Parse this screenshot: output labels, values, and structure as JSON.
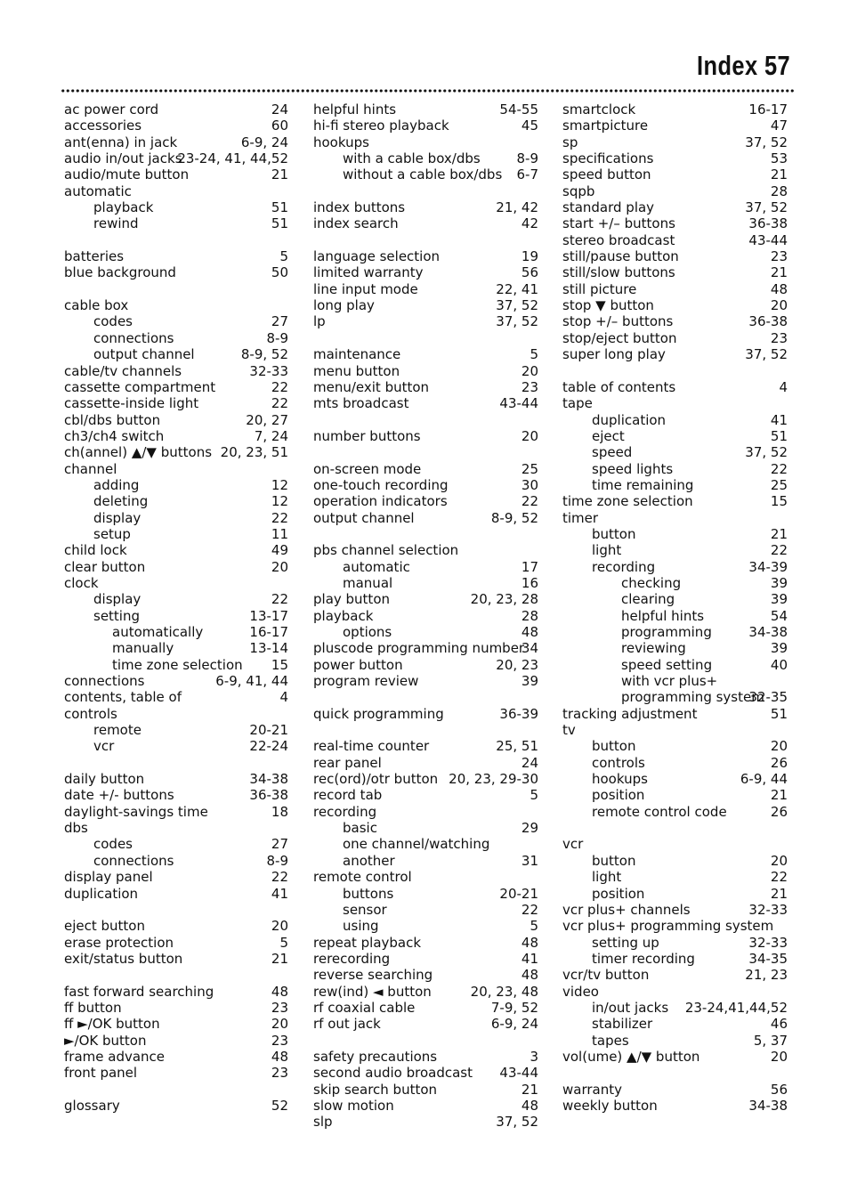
{
  "header": {
    "title": "Index 57"
  },
  "columns": [
    [
      {
        "t": "ac power cord",
        "p": "24",
        "l": 0
      },
      {
        "t": "accessories",
        "p": "60",
        "l": 0
      },
      {
        "t": "ant(enna) in jack",
        "p": "6-9, 24",
        "l": 0
      },
      {
        "t": "audio in/out jacks",
        "p": "23-24, 41, 44,52",
        "l": 0
      },
      {
        "t": "audio/mute button",
        "p": "21",
        "l": 0
      },
      {
        "t": "automatic",
        "p": "",
        "l": 0
      },
      {
        "t": "playback",
        "p": "51",
        "l": 1
      },
      {
        "t": "rewind",
        "p": "51",
        "l": 1
      },
      {
        "t": "",
        "p": "",
        "l": 0
      },
      {
        "t": "batteries",
        "p": "5",
        "l": 0
      },
      {
        "t": "blue background",
        "p": "50",
        "l": 0
      },
      {
        "t": "",
        "p": "",
        "l": 0
      },
      {
        "t": "cable box",
        "p": "",
        "l": 0
      },
      {
        "t": "codes",
        "p": "27",
        "l": 1
      },
      {
        "t": "connections",
        "p": "8-9",
        "l": 1
      },
      {
        "t": "output channel",
        "p": "8-9, 52",
        "l": 1
      },
      {
        "t": "cable/tv channels",
        "p": "32-33",
        "l": 0
      },
      {
        "t": "cassette compartment",
        "p": "22",
        "l": 0
      },
      {
        "t": "cassette-inside light",
        "p": "22",
        "l": 0
      },
      {
        "t": "cbl/dbs button",
        "p": "20, 27",
        "l": 0
      },
      {
        "t": "ch3/ch4 switch",
        "p": "7, 24",
        "l": 0
      },
      {
        "t": "ch(annel) ▲/▼ buttons",
        "p": "20, 23, 51",
        "l": 0
      },
      {
        "t": "channel",
        "p": "",
        "l": 0
      },
      {
        "t": "adding",
        "p": "12",
        "l": 1
      },
      {
        "t": "deleting",
        "p": "12",
        "l": 1
      },
      {
        "t": "display",
        "p": "22",
        "l": 1
      },
      {
        "t": "setup",
        "p": "11",
        "l": 1
      },
      {
        "t": "child lock",
        "p": "49",
        "l": 0
      },
      {
        "t": "clear button",
        "p": "20",
        "l": 0
      },
      {
        "t": "clock",
        "p": "",
        "l": 0
      },
      {
        "t": "display",
        "p": "22",
        "l": 1
      },
      {
        "t": "setting",
        "p": "13-17",
        "l": 1
      },
      {
        "t": "automatically",
        "p": "16-17",
        "l": 2
      },
      {
        "t": "manually",
        "p": "13-14",
        "l": 2
      },
      {
        "t": "time zone selection",
        "p": "15",
        "l": 2
      },
      {
        "t": "connections",
        "p": "6-9, 41, 44",
        "l": 0
      },
      {
        "t": "contents, table of",
        "p": "4",
        "l": 0
      },
      {
        "t": "controls",
        "p": "",
        "l": 0
      },
      {
        "t": "remote",
        "p": "20-21",
        "l": 1
      },
      {
        "t": "vcr",
        "p": "22-24",
        "l": 1
      },
      {
        "t": "",
        "p": "",
        "l": 0
      },
      {
        "t": "daily button",
        "p": "34-38",
        "l": 0
      },
      {
        "t": "date +/- buttons",
        "p": "36-38",
        "l": 0
      },
      {
        "t": "daylight-savings time",
        "p": "18",
        "l": 0
      },
      {
        "t": "dbs",
        "p": "",
        "l": 0
      },
      {
        "t": "codes",
        "p": "27",
        "l": 1
      },
      {
        "t": "connections",
        "p": "8-9",
        "l": 1
      },
      {
        "t": "display panel",
        "p": "22",
        "l": 0
      },
      {
        "t": "duplication",
        "p": "41",
        "l": 0
      },
      {
        "t": "",
        "p": "",
        "l": 0
      },
      {
        "t": "eject button",
        "p": "20",
        "l": 0
      },
      {
        "t": "erase protection",
        "p": "5",
        "l": 0
      },
      {
        "t": "exit/status button",
        "p": "21",
        "l": 0
      },
      {
        "t": "",
        "p": "",
        "l": 0
      },
      {
        "t": "fast forward searching",
        "p": "48",
        "l": 0
      },
      {
        "t": "ff button",
        "p": "23",
        "l": 0
      },
      {
        "t": "ff ►/OK button",
        "p": "20",
        "l": 0
      },
      {
        "t": "►/OK button",
        "p": "23",
        "l": 0
      },
      {
        "t": "frame advance",
        "p": "48",
        "l": 0
      },
      {
        "t": "front panel",
        "p": "23",
        "l": 0
      },
      {
        "t": "",
        "p": "",
        "l": 0
      },
      {
        "t": "glossary",
        "p": "52",
        "l": 0
      }
    ],
    [
      {
        "t": "helpful hints",
        "p": "54-55",
        "l": 0
      },
      {
        "t": "hi-fi stereo playback",
        "p": "45",
        "l": 0
      },
      {
        "t": "hookups",
        "p": "",
        "l": 0
      },
      {
        "t": "with a cable box/dbs",
        "p": "8-9",
        "l": 1
      },
      {
        "t": "without a cable box/dbs",
        "p": "6-7",
        "l": 1
      },
      {
        "t": "",
        "p": "",
        "l": 0
      },
      {
        "t": "index buttons",
        "p": "21, 42",
        "l": 0
      },
      {
        "t": "index search",
        "p": "42",
        "l": 0
      },
      {
        "t": "",
        "p": "",
        "l": 0
      },
      {
        "t": "language selection",
        "p": "19",
        "l": 0
      },
      {
        "t": "limited warranty",
        "p": "56",
        "l": 0
      },
      {
        "t": "line input mode",
        "p": "22, 41",
        "l": 0
      },
      {
        "t": "long play",
        "p": "37, 52",
        "l": 0
      },
      {
        "t": "lp",
        "p": "37, 52",
        "l": 0
      },
      {
        "t": "",
        "p": "",
        "l": 0
      },
      {
        "t": "maintenance",
        "p": "5",
        "l": 0
      },
      {
        "t": "menu button",
        "p": "20",
        "l": 0
      },
      {
        "t": "menu/exit button",
        "p": "23",
        "l": 0
      },
      {
        "t": "mts broadcast",
        "p": "43-44",
        "l": 0
      },
      {
        "t": "",
        "p": "",
        "l": 0
      },
      {
        "t": "number buttons",
        "p": "20",
        "l": 0
      },
      {
        "t": "",
        "p": "",
        "l": 0
      },
      {
        "t": "on-screen mode",
        "p": "25",
        "l": 0
      },
      {
        "t": "one-touch recording",
        "p": "30",
        "l": 0
      },
      {
        "t": "operation indicators",
        "p": "22",
        "l": 0
      },
      {
        "t": "output channel",
        "p": "8-9, 52",
        "l": 0
      },
      {
        "t": "",
        "p": "",
        "l": 0
      },
      {
        "t": "pbs channel selection",
        "p": "",
        "l": 0
      },
      {
        "t": "automatic",
        "p": "17",
        "l": 1
      },
      {
        "t": "manual",
        "p": "16",
        "l": 1
      },
      {
        "t": "play button",
        "p": "20, 23, 28",
        "l": 0
      },
      {
        "t": "playback",
        "p": "28",
        "l": 0
      },
      {
        "t": "options",
        "p": "48",
        "l": 1
      },
      {
        "t": "pluscode programming number",
        "p": "34",
        "l": 0
      },
      {
        "t": "power button",
        "p": "20, 23",
        "l": 0
      },
      {
        "t": "program review",
        "p": "39",
        "l": 0
      },
      {
        "t": "",
        "p": "",
        "l": 0
      },
      {
        "t": "quick programming",
        "p": "36-39",
        "l": 0
      },
      {
        "t": "",
        "p": "",
        "l": 0
      },
      {
        "t": "real-time counter",
        "p": "25, 51",
        "l": 0
      },
      {
        "t": "rear panel",
        "p": "24",
        "l": 0
      },
      {
        "t": "rec(ord)/otr button",
        "p": "20, 23, 29-30",
        "l": 0
      },
      {
        "t": "record tab",
        "p": "5",
        "l": 0
      },
      {
        "t": "recording",
        "p": "",
        "l": 0
      },
      {
        "t": "basic",
        "p": "29",
        "l": 1
      },
      {
        "t": "one channel/watching",
        "p": "",
        "l": 1
      },
      {
        "t": "another",
        "p": "31",
        "l": 1
      },
      {
        "t": "remote control",
        "p": "",
        "l": 0
      },
      {
        "t": "buttons",
        "p": "20-21",
        "l": 1
      },
      {
        "t": "sensor",
        "p": "22",
        "l": 1
      },
      {
        "t": "using",
        "p": "5",
        "l": 1
      },
      {
        "t": "repeat playback",
        "p": "48",
        "l": 0
      },
      {
        "t": "rerecording",
        "p": "41",
        "l": 0
      },
      {
        "t": "reverse searching",
        "p": "48",
        "l": 0
      },
      {
        "t": "rew(ind) ◄ button",
        "p": "20, 23, 48",
        "l": 0
      },
      {
        "t": "rf coaxial cable",
        "p": "7-9, 52",
        "l": 0
      },
      {
        "t": "rf out jack",
        "p": "6-9, 24",
        "l": 0
      },
      {
        "t": "",
        "p": "",
        "l": 0
      },
      {
        "t": "safety precautions",
        "p": "3",
        "l": 0
      },
      {
        "t": "second audio broadcast",
        "p": "43-44",
        "l": 0
      },
      {
        "t": "skip search button",
        "p": "21",
        "l": 0
      },
      {
        "t": "slow motion",
        "p": "48",
        "l": 0
      },
      {
        "t": "slp",
        "p": "37, 52",
        "l": 0
      }
    ],
    [
      {
        "t": "smartclock",
        "p": "16-17",
        "l": 0
      },
      {
        "t": "smartpicture",
        "p": "47",
        "l": 0
      },
      {
        "t": "sp",
        "p": "37, 52",
        "l": 0
      },
      {
        "t": "specifications",
        "p": "53",
        "l": 0
      },
      {
        "t": "speed button",
        "p": "21",
        "l": 0
      },
      {
        "t": "sqpb",
        "p": "28",
        "l": 0
      },
      {
        "t": "standard play",
        "p": "37, 52",
        "l": 0
      },
      {
        "t": "start +/– buttons",
        "p": "36-38",
        "l": 0
      },
      {
        "t": "stereo broadcast",
        "p": "43-44",
        "l": 0
      },
      {
        "t": "still/pause button",
        "p": "23",
        "l": 0
      },
      {
        "t": "still/slow buttons",
        "p": "21",
        "l": 0
      },
      {
        "t": "still picture",
        "p": "48",
        "l": 0
      },
      {
        "t": "stop ▼ button",
        "p": "20",
        "l": 0
      },
      {
        "t": "stop +/– buttons",
        "p": "36-38",
        "l": 0
      },
      {
        "t": "stop/eject button",
        "p": "23",
        "l": 0
      },
      {
        "t": "super long play",
        "p": "37, 52",
        "l": 0
      },
      {
        "t": "",
        "p": "",
        "l": 0
      },
      {
        "t": "table of contents",
        "p": "4",
        "l": 0
      },
      {
        "t": "tape",
        "p": "",
        "l": 0
      },
      {
        "t": "duplication",
        "p": "41",
        "l": 1
      },
      {
        "t": "eject",
        "p": "51",
        "l": 1
      },
      {
        "t": "speed",
        "p": "37, 52",
        "l": 1
      },
      {
        "t": "speed lights",
        "p": "22",
        "l": 1
      },
      {
        "t": "time remaining",
        "p": "25",
        "l": 1
      },
      {
        "t": "time zone selection",
        "p": "15",
        "l": 0
      },
      {
        "t": "timer",
        "p": "",
        "l": 0
      },
      {
        "t": "button",
        "p": "21",
        "l": 1
      },
      {
        "t": "light",
        "p": "22",
        "l": 1
      },
      {
        "t": "recording",
        "p": "34-39",
        "l": 1
      },
      {
        "t": "checking",
        "p": "39",
        "l": 2
      },
      {
        "t": "clearing",
        "p": "39",
        "l": 2
      },
      {
        "t": "helpful hints",
        "p": "54",
        "l": 2
      },
      {
        "t": "programming",
        "p": "34-38",
        "l": 2
      },
      {
        "t": "reviewing",
        "p": "39",
        "l": 2
      },
      {
        "t": "speed setting",
        "p": "40",
        "l": 2
      },
      {
        "t": "with vcr plus+",
        "p": "",
        "l": 2
      },
      {
        "t": "programming system",
        "p": "32-35",
        "l": 2
      },
      {
        "t": "tracking adjustment",
        "p": "51",
        "l": 0
      },
      {
        "t": "tv",
        "p": "",
        "l": 0
      },
      {
        "t": "button",
        "p": "20",
        "l": 1
      },
      {
        "t": "controls",
        "p": "26",
        "l": 1
      },
      {
        "t": "hookups",
        "p": "6-9, 44",
        "l": 1
      },
      {
        "t": "position",
        "p": "21",
        "l": 1
      },
      {
        "t": "remote control code",
        "p": "26",
        "l": 1
      },
      {
        "t": "",
        "p": "",
        "l": 0
      },
      {
        "t": "vcr",
        "p": "",
        "l": 0
      },
      {
        "t": "button",
        "p": "20",
        "l": 1
      },
      {
        "t": "light",
        "p": "22",
        "l": 1
      },
      {
        "t": "position",
        "p": "21",
        "l": 1
      },
      {
        "t": "vcr plus+ channels",
        "p": "32-33",
        "l": 0
      },
      {
        "t": "vcr plus+ programming system",
        "p": "",
        "l": 0
      },
      {
        "t": "setting up",
        "p": "32-33",
        "l": 1
      },
      {
        "t": "timer recording",
        "p": "34-35",
        "l": 1
      },
      {
        "t": "vcr/tv button",
        "p": "21, 23",
        "l": 0
      },
      {
        "t": "video",
        "p": "",
        "l": 0
      },
      {
        "t": "in/out jacks",
        "p": "23-24,41,44,52",
        "l": 1
      },
      {
        "t": "stabilizer",
        "p": "46",
        "l": 1
      },
      {
        "t": "tapes",
        "p": "5, 37",
        "l": 1
      },
      {
        "t": "vol(ume) ▲/▼ button",
        "p": "20",
        "l": 0
      },
      {
        "t": "",
        "p": "",
        "l": 0
      },
      {
        "t": "warranty",
        "p": "56",
        "l": 0
      },
      {
        "t": "weekly button",
        "p": "34-38",
        "l": 0
      }
    ]
  ]
}
